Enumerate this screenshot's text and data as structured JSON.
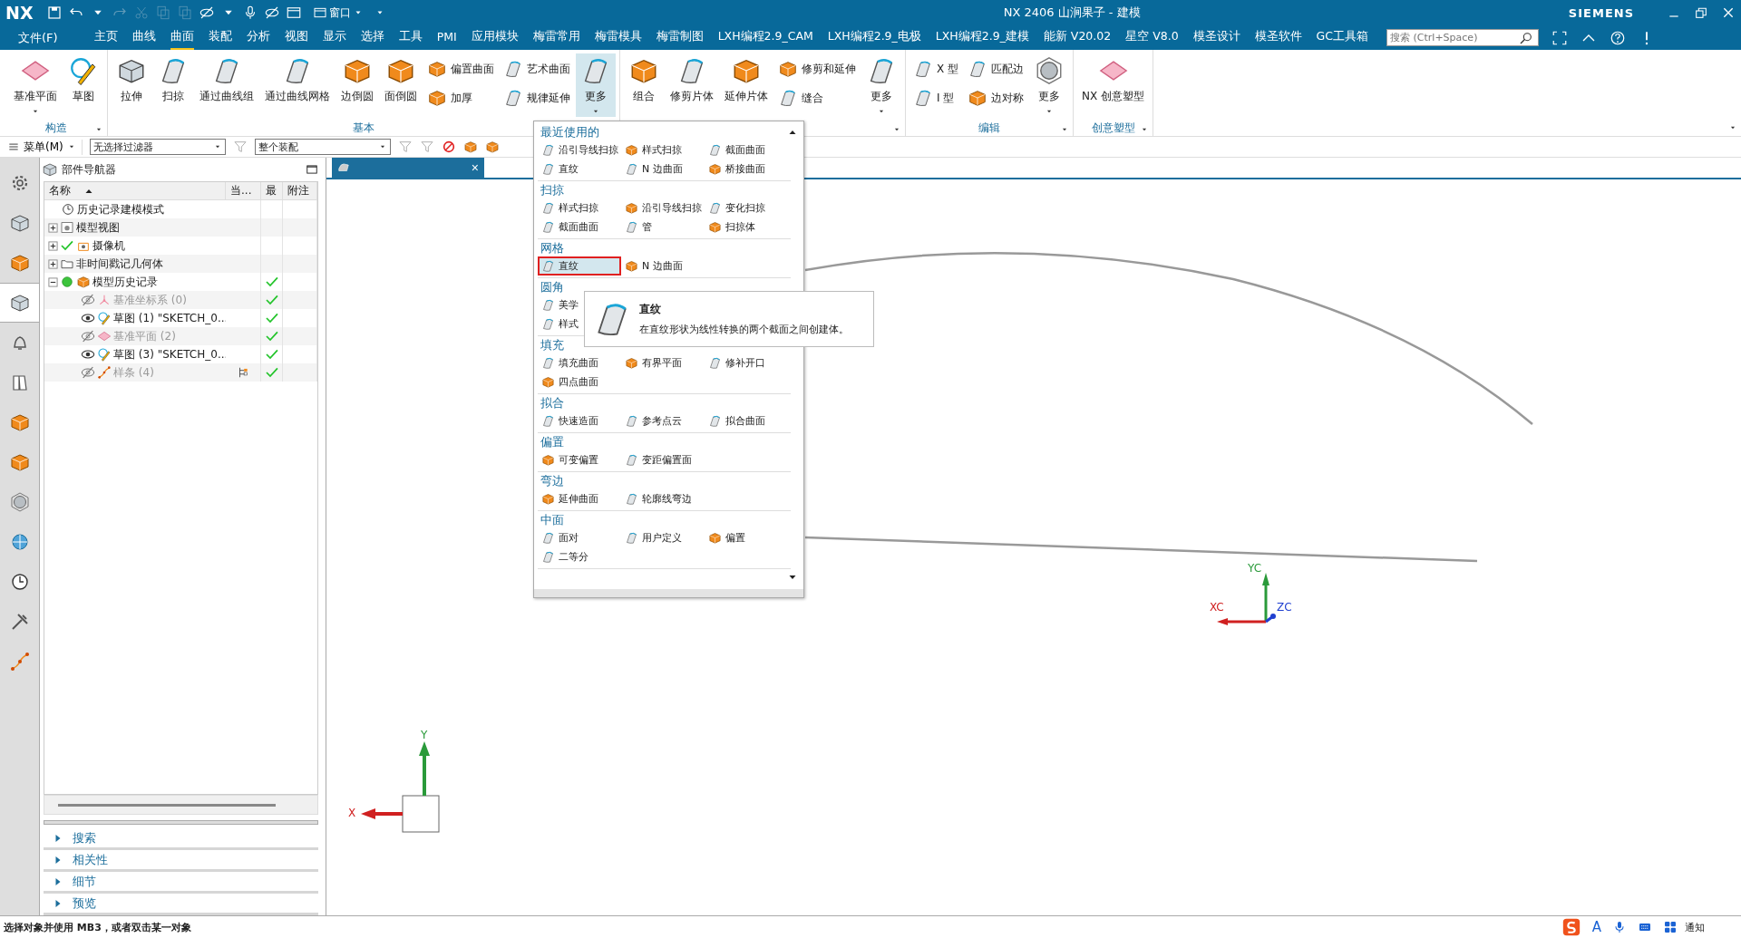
{
  "window": {
    "logo": "NX",
    "window_menu": "窗口",
    "title": "NX 2406 山涧果子 - 建模",
    "brand": "SIEMENS"
  },
  "menu_bar": {
    "file": "文件(F)",
    "tabs": [
      {
        "label": "主页",
        "selected": false
      },
      {
        "label": "曲线",
        "selected": false
      },
      {
        "label": "曲面",
        "selected": true
      },
      {
        "label": "装配",
        "selected": false
      },
      {
        "label": "分析",
        "selected": false
      },
      {
        "label": "视图",
        "selected": false
      },
      {
        "label": "显示",
        "selected": false
      },
      {
        "label": "选择",
        "selected": false
      },
      {
        "label": "工具",
        "selected": false
      },
      {
        "label": "PMI",
        "selected": false
      },
      {
        "label": "应用模块",
        "selected": false
      },
      {
        "label": "梅雷常用",
        "selected": false
      },
      {
        "label": "梅雷模具",
        "selected": false
      },
      {
        "label": "梅雷制图",
        "selected": false
      },
      {
        "label": "LXH编程2.9_CAM",
        "selected": false
      },
      {
        "label": "LXH编程2.9_电极",
        "selected": false
      },
      {
        "label": "LXH编程2.9_建模",
        "selected": false
      },
      {
        "label": "能新 V20.02",
        "selected": false
      },
      {
        "label": "星空 V8.0",
        "selected": false
      },
      {
        "label": "模圣设计",
        "selected": false
      },
      {
        "label": "模圣软件",
        "selected": false
      },
      {
        "label": "GC工具箱",
        "selected": false
      }
    ],
    "search": {
      "placeholder": "搜索 (Ctrl+Space)"
    }
  },
  "ribbon": {
    "groups": [
      {
        "label": "构造",
        "options": true,
        "items": [
          {
            "kind": "large",
            "label": "基准平面",
            "dropdown": true
          },
          {
            "kind": "large",
            "label": "草图"
          }
        ]
      },
      {
        "label": "基本",
        "options": false,
        "items": [
          {
            "kind": "large",
            "label": "拉伸"
          },
          {
            "kind": "large",
            "label": "扫掠"
          },
          {
            "kind": "large",
            "label": "通过曲线组"
          },
          {
            "kind": "large",
            "label": "通过曲线网格"
          },
          {
            "kind": "large",
            "label": "边倒圆"
          },
          {
            "kind": "large",
            "label": "面倒圆"
          },
          {
            "kind": "stack",
            "items": [
              {
                "label": "偏置曲面"
              },
              {
                "label": "加厚"
              }
            ]
          },
          {
            "kind": "stack",
            "items": [
              {
                "label": "艺术曲面"
              },
              {
                "label": "规律延伸"
              }
            ]
          },
          {
            "kind": "large",
            "label": "更多",
            "dropdown": true,
            "open": true
          }
        ]
      },
      {
        "options": true,
        "items": [
          {
            "kind": "large",
            "label": "组合"
          },
          {
            "kind": "large",
            "label": "修剪片体"
          },
          {
            "kind": "large",
            "label": "延伸片体"
          },
          {
            "kind": "stack",
            "items": [
              {
                "label": "修剪和延伸"
              },
              {
                "label": "缝合"
              }
            ]
          },
          {
            "kind": "large",
            "label": "更多",
            "dropdown": true,
            "open": false
          }
        ]
      },
      {
        "label": "编辑",
        "options": true,
        "items": [
          {
            "kind": "stack",
            "items": [
              {
                "label": "X 型"
              },
              {
                "label": "I 型"
              }
            ]
          },
          {
            "kind": "stack",
            "items": [
              {
                "label": "匹配边"
              },
              {
                "label": "边对称"
              }
            ]
          },
          {
            "kind": "large",
            "label": "更多",
            "dropdown": true,
            "open": false
          }
        ]
      },
      {
        "label": "创意塑型",
        "options": true,
        "items": [
          {
            "kind": "large",
            "label": "NX 创意塑型"
          }
        ]
      }
    ]
  },
  "selection_bar": {
    "menu": "菜单(M)",
    "filter": "无选择过滤器",
    "scope": "整个装配"
  },
  "left_toolbar": [
    {
      "selected": false
    },
    {
      "selected": false
    },
    {
      "selected": false
    },
    {
      "selected": true
    },
    {
      "selected": false
    },
    {
      "selected": false
    },
    {
      "selected": false
    },
    {
      "selected": false
    },
    {
      "selected": false
    },
    {
      "selected": false
    },
    {
      "selected": false
    },
    {
      "selected": false
    },
    {
      "selected": false
    }
  ],
  "navigator": {
    "title": "部件导航器",
    "columns": [
      "名称",
      "当...",
      "最",
      "附注"
    ],
    "rows": [
      {
        "kind": "mode",
        "label": "历史记录建模模式"
      },
      {
        "kind": "view",
        "label": "模型视图",
        "expanded": false
      },
      {
        "kind": "camera",
        "label": "摄像机",
        "expanded": false,
        "checked": true
      },
      {
        "kind": "folder",
        "label": "非时间戳记几何体",
        "expanded": false
      },
      {
        "kind": "history",
        "label": "模型历史记录",
        "expanded": true,
        "latest": true,
        "children": [
          {
            "kind": "csys",
            "label": "基准坐标系 (0)",
            "hidden": true,
            "latest": true
          },
          {
            "kind": "sketch",
            "label": "草图 (1) \"SKETCH_0...",
            "hidden": false,
            "latest": true
          },
          {
            "kind": "plane",
            "label": "基准平面 (2)",
            "hidden": true,
            "latest": true
          },
          {
            "kind": "sketch",
            "label": "草图 (3) \"SKETCH_0...",
            "hidden": false,
            "latest": true
          },
          {
            "kind": "spline",
            "label": "样条 (4)",
            "hidden": true,
            "latest": true,
            "current": true
          }
        ]
      }
    ],
    "sections": [
      {
        "label": "搜索",
        "expanded": false
      },
      {
        "label": "相关性",
        "expanded": false
      },
      {
        "label": "细节",
        "expanded": false
      },
      {
        "label": "预览",
        "expanded": false
      }
    ]
  },
  "graphics": {
    "tab_close": "×",
    "axes": {
      "wcs_y": "YC",
      "wcs_x": "XC",
      "wcs_z": "ZC",
      "abs_y": "Y",
      "abs_x": "X"
    }
  },
  "more_menu": {
    "sections": [
      {
        "title": "最近使用的",
        "rows": [
          [
            {
              "label": "沿引导线扫掠",
              "selected": false
            },
            {
              "label": "样式扫掠",
              "selected": false
            },
            {
              "label": "截面曲面",
              "selected": false
            }
          ],
          [
            {
              "label": "直纹",
              "selected": false
            },
            {
              "label": "N 边曲面",
              "selected": false
            },
            {
              "label": "桥接曲面",
              "selected": false
            }
          ]
        ]
      },
      {
        "title": "扫掠",
        "rows": [
          [
            {
              "label": "样式扫掠",
              "selected": false
            },
            {
              "label": "沿引导线扫掠",
              "selected": false
            },
            {
              "label": "变化扫掠",
              "selected": false
            }
          ],
          [
            {
              "label": "截面曲面",
              "selected": false
            },
            {
              "label": "管",
              "selected": false
            },
            {
              "label": "扫掠体",
              "selected": false
            }
          ]
        ]
      },
      {
        "title": "网格",
        "rows": [
          [
            {
              "label": "直纹",
              "selected": true
            },
            {
              "label": "N 边曲面",
              "selected": false
            }
          ]
        ]
      },
      {
        "title": "圆角",
        "rows": [
          [
            {
              "label": "美学",
              "selected": false
            }
          ],
          [
            {
              "label": "样式",
              "selected": false
            }
          ]
        ]
      },
      {
        "title": "填充",
        "rows": [
          [
            {
              "label": "填充曲面",
              "selected": false
            },
            {
              "label": "有界平面",
              "selected": false
            },
            {
              "label": "修补开口",
              "selected": false
            }
          ],
          [
            {
              "label": "四点曲面",
              "selected": false
            }
          ]
        ]
      },
      {
        "title": "拟合",
        "rows": [
          [
            {
              "label": "快速造面",
              "selected": false
            },
            {
              "label": "参考点云",
              "selected": false
            },
            {
              "label": "拟合曲面",
              "selected": false
            }
          ]
        ]
      },
      {
        "title": "偏置",
        "rows": [
          [
            {
              "label": "可变偏置",
              "selected": false
            },
            {
              "label": "变距偏置面",
              "selected": false
            }
          ]
        ]
      },
      {
        "title": "弯边",
        "rows": [
          [
            {
              "label": "延伸曲面",
              "selected": false
            },
            {
              "label": "轮廓线弯边",
              "selected": false
            }
          ]
        ]
      },
      {
        "title": "中面",
        "rows": [
          [
            {
              "label": "面对",
              "selected": false
            },
            {
              "label": "用户定义",
              "selected": false
            },
            {
              "label": "偏置",
              "selected": false
            }
          ],
          [
            {
              "label": "二等分",
              "selected": false
            }
          ]
        ]
      }
    ]
  },
  "tooltip": {
    "title": "直纹",
    "text": "在直纹形状为线性转换的两个截面之间创建体。"
  },
  "status_bar": {
    "message": "选择对象并使用 MB3，或者双击某一对象",
    "ime_letter": "A",
    "notice": "通知"
  }
}
